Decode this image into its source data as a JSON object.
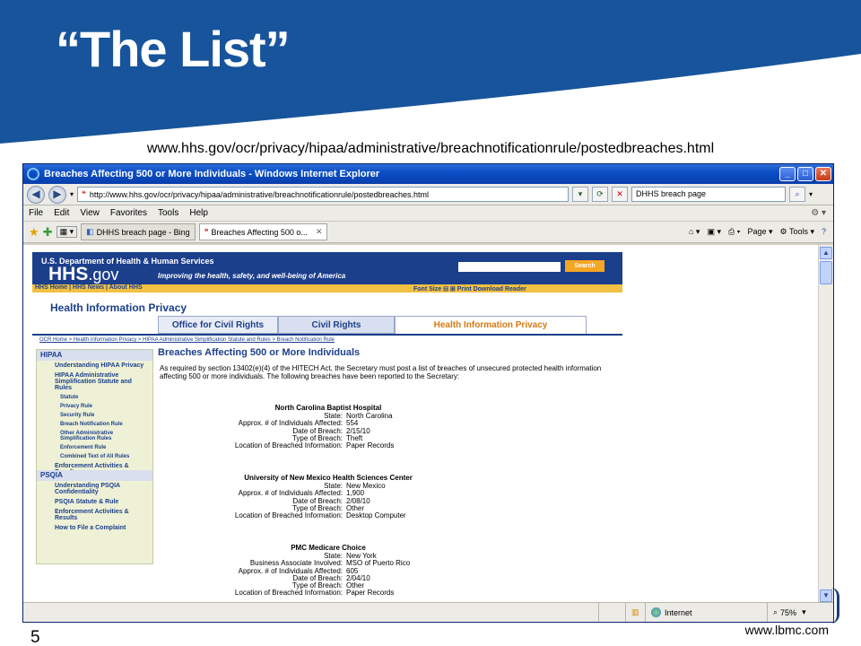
{
  "slide": {
    "title": "“The List”",
    "url": "www.hhs.gov/ocr/privacy/hipaa/administrative/breachnotificationrule/postedbreaches.html",
    "number": "5",
    "footer": "www.lbmc.com",
    "header_color": "#17549b"
  },
  "browser": {
    "window_title": "Breaches Affecting 500 or More Individuals - Windows Internet Explorer",
    "address": "http://www.hhs.gov/ocr/privacy/hipaa/administrative/breachnotificationrule/postedbreaches.html",
    "search_value": "DHHS breach page",
    "menu": [
      "File",
      "Edit",
      "View",
      "Favorites",
      "Tools",
      "Help"
    ],
    "tabs": [
      {
        "label": "DHHS breach page - Bing"
      },
      {
        "label": "Breaches Affecting 500 o..."
      }
    ],
    "tools": {
      "page": "Page",
      "tools": "Tools"
    },
    "status": {
      "zone": "Internet",
      "zoom": "75%"
    }
  },
  "hhs_page": {
    "dept_name": "U.S. Department of Health & Human Services",
    "logo_main": "HHS",
    "logo_suffix": ".gov",
    "tagline": "Improving the health, safety, and well-being of America",
    "search_button": "Search",
    "nav_links": "HHS Home | HHS News | About HHS",
    "font_size_label": "Font Size",
    "print_download": "Print   Download Reader",
    "section_heading": "Health Information Privacy",
    "tabs": [
      "Office for Civil Rights",
      "Civil Rights",
      "Health Information Privacy"
    ],
    "breadcrumb": "OCR Home > Health Information Privacy > HIPAA Administrative Simplification Statute and Rules > Breach Notification Rule",
    "sidebar": {
      "hipaa_heading": "HIPAA",
      "hipaa_items": [
        {
          "label": "Understanding HIPAA Privacy",
          "type": "item"
        },
        {
          "label": "HIPAA Administrative Simplification Statute and Rules",
          "type": "item"
        },
        {
          "label": "Statute",
          "type": "sub"
        },
        {
          "label": "Privacy Rule",
          "type": "sub"
        },
        {
          "label": "Security Rule",
          "type": "sub"
        },
        {
          "label": "Breach Notification Rule",
          "type": "sub"
        },
        {
          "label": "Other Administrative Simplification Rules",
          "type": "sub"
        },
        {
          "label": "Enforcement Rule",
          "type": "sub"
        },
        {
          "label": "Combined Text of All Rules",
          "type": "sub"
        },
        {
          "label": "Enforcement Activities & Results",
          "type": "item"
        }
      ],
      "psqia_heading": "PSQIA",
      "psqia_items": [
        {
          "label": "Understanding PSQIA Confidentiality"
        },
        {
          "label": "PSQIA Statute & Rule"
        },
        {
          "label": "Enforcement Activities & Results"
        },
        {
          "label": "How to File a Complaint"
        }
      ]
    },
    "content_title": "Breaches Affecting 500 or More Individuals",
    "intro": "As required by section 13402(e)(4) of the HITECH Act, the Secretary must post a list of breaches of unsecured protected health information affecting 500 or more individuals. The following breaches have been reported to the Secretary:",
    "breaches": [
      {
        "name": "North Carolina Baptist Hospital",
        "rows": [
          {
            "label": "State:",
            "value": "North Carolina"
          },
          {
            "label": "Approx. # of Individuals Affected:",
            "value": "554"
          },
          {
            "label": "Date of Breach:",
            "value": "2/15/10"
          },
          {
            "label": "Type of Breach:",
            "value": "Theft"
          },
          {
            "label": "Location of Breached Information:",
            "value": "Paper Records"
          }
        ]
      },
      {
        "name": "University of New Mexico Health Sciences Center",
        "rows": [
          {
            "label": "State:",
            "value": "New Mexico"
          },
          {
            "label": "Approx. # of Individuals Affected:",
            "value": "1,900"
          },
          {
            "label": "Date of Breach:",
            "value": "2/08/10"
          },
          {
            "label": "Type of Breach:",
            "value": "Other"
          },
          {
            "label": "Location of Breached Information:",
            "value": "Desktop Computer"
          }
        ]
      },
      {
        "name": "PMC Medicare Choice",
        "rows": [
          {
            "label": "State:",
            "value": "New York"
          },
          {
            "label": "Business Associate Involved:",
            "value": "MSO of Puerto Rico"
          },
          {
            "label": "Approx. # of Individuals Affected:",
            "value": "605"
          },
          {
            "label": "Date of Breach:",
            "value": "2/04/10"
          },
          {
            "label": "Type of Breach:",
            "value": "Other"
          },
          {
            "label": "Location of Breached Information:",
            "value": "Paper Records"
          }
        ]
      }
    ]
  }
}
